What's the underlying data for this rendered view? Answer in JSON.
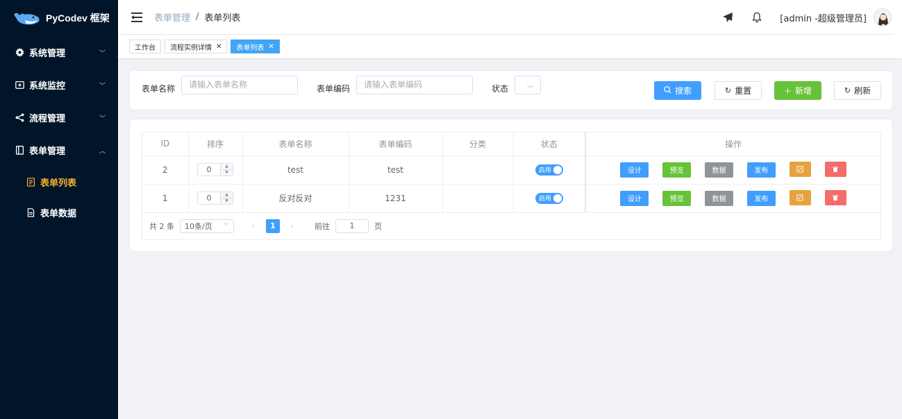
{
  "brand": {
    "name": "PyCodev 框架"
  },
  "sidebar": {
    "items": [
      {
        "label": "系统管理",
        "icon": "gear-icon",
        "chevron": "﹀"
      },
      {
        "label": "系统监控",
        "icon": "monitor-icon",
        "chevron": "﹀"
      },
      {
        "label": "流程管理",
        "icon": "share-icon",
        "chevron": "﹀"
      },
      {
        "label": "表单管理",
        "icon": "form-icon",
        "chevron": "︿"
      }
    ],
    "subitems": [
      {
        "label": "表单列表",
        "icon": "list-doc-icon",
        "active": true
      },
      {
        "label": "表单数据",
        "icon": "doc-icon",
        "active": false
      }
    ]
  },
  "header": {
    "breadcrumb": {
      "parent": "表单管理",
      "separator": "/",
      "current": "表单列表"
    },
    "user": "[admin -超级管理员]"
  },
  "tags": [
    {
      "label": "工作台",
      "closable": false,
      "active": false
    },
    {
      "label": "流程实例详情",
      "closable": true,
      "active": false
    },
    {
      "label": "表单列表",
      "closable": true,
      "active": true
    }
  ],
  "search": {
    "name_label": "表单名称",
    "name_placeholder": "请输入表单名称",
    "code_label": "表单编码",
    "code_placeholder": "请输入表单编码",
    "status_label": "状态",
    "search_btn": "搜索",
    "reset_btn": "重置",
    "add_btn": "新增",
    "refresh_btn": "刷新"
  },
  "table": {
    "columns": [
      "ID",
      "排序",
      "表单名称",
      "表单编码",
      "分类",
      "状态",
      "操作"
    ],
    "rows": [
      {
        "id": "2",
        "sort": "0",
        "name": "test",
        "code": "test",
        "category": "",
        "status": "启用"
      },
      {
        "id": "1",
        "sort": "0",
        "name": "反对反对",
        "code": "1231",
        "category": "",
        "status": "启用"
      }
    ],
    "actions": {
      "design": "设计",
      "preview": "预览",
      "data": "数据",
      "publish": "发布"
    }
  },
  "pagination": {
    "total": "共 2 条",
    "page_size": "10条/页",
    "current": "1",
    "goto_label": "前往",
    "goto_value": "1",
    "page_suffix": "页"
  },
  "colors": {
    "sidebar_bg": "#001529",
    "active_menu": "#f5b533",
    "primary": "#409eff",
    "success": "#67c23a",
    "info": "#909399",
    "warning": "#e6a23c",
    "danger": "#f56c6c"
  }
}
